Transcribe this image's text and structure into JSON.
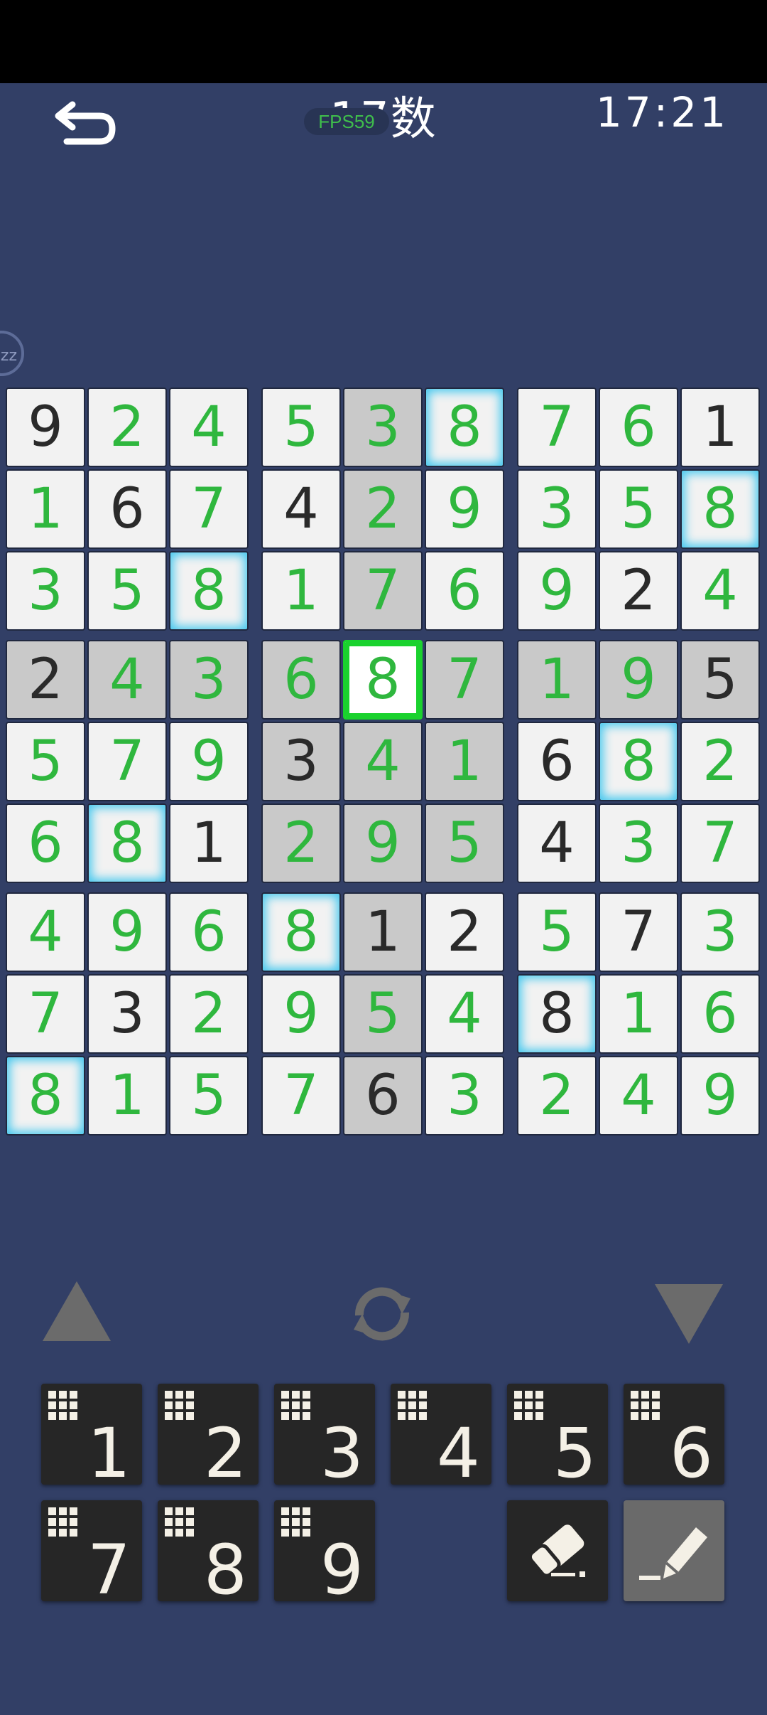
{
  "header": {
    "title": "17数",
    "fps": "FPS59",
    "timer": "17:21",
    "side_badge": "zz"
  },
  "board": [
    [
      "9g",
      "2e",
      "4e",
      "5e",
      "3e",
      "8e",
      "7e",
      "6e",
      "1g"
    ],
    [
      "1e",
      "6g",
      "7e",
      "4g",
      "2e",
      "9e",
      "3e",
      "5e",
      "8e"
    ],
    [
      "3e",
      "5e",
      "8e",
      "1e",
      "7e",
      "6e",
      "9e",
      "2g",
      "4e"
    ],
    [
      "2g",
      "4e",
      "3e",
      "6e",
      "8e",
      "7e",
      "1e",
      "9e",
      "5g"
    ],
    [
      "5e",
      "7e",
      "9e",
      "3g",
      "4e",
      "1e",
      "6g",
      "8e",
      "2e"
    ],
    [
      "6e",
      "8e",
      "1g",
      "2e",
      "9e",
      "5e",
      "4g",
      "3e",
      "7e"
    ],
    [
      "4e",
      "9e",
      "6e",
      "8e",
      "1g",
      "2g",
      "5e",
      "7g",
      "3e"
    ],
    [
      "7e",
      "3g",
      "2e",
      "9e",
      "5e",
      "4e",
      "8g",
      "1e",
      "6e"
    ],
    [
      "8e",
      "1e",
      "5e",
      "7e",
      "6g",
      "3e",
      "2e",
      "4e",
      "9e"
    ]
  ],
  "selected_cell": {
    "row": 3,
    "col": 4
  },
  "highlight_digit": "8",
  "colors": {
    "background": "#323f66",
    "given": "#2a2a2a",
    "entered": "#2fb73e",
    "highlight": "#45c8ee",
    "selected": "#1ad22e"
  },
  "keypad": {
    "digits": [
      "1",
      "2",
      "3",
      "4",
      "5",
      "6",
      "7",
      "8",
      "9"
    ],
    "tools": [
      "eraser-icon",
      "pencil-icon"
    ]
  }
}
